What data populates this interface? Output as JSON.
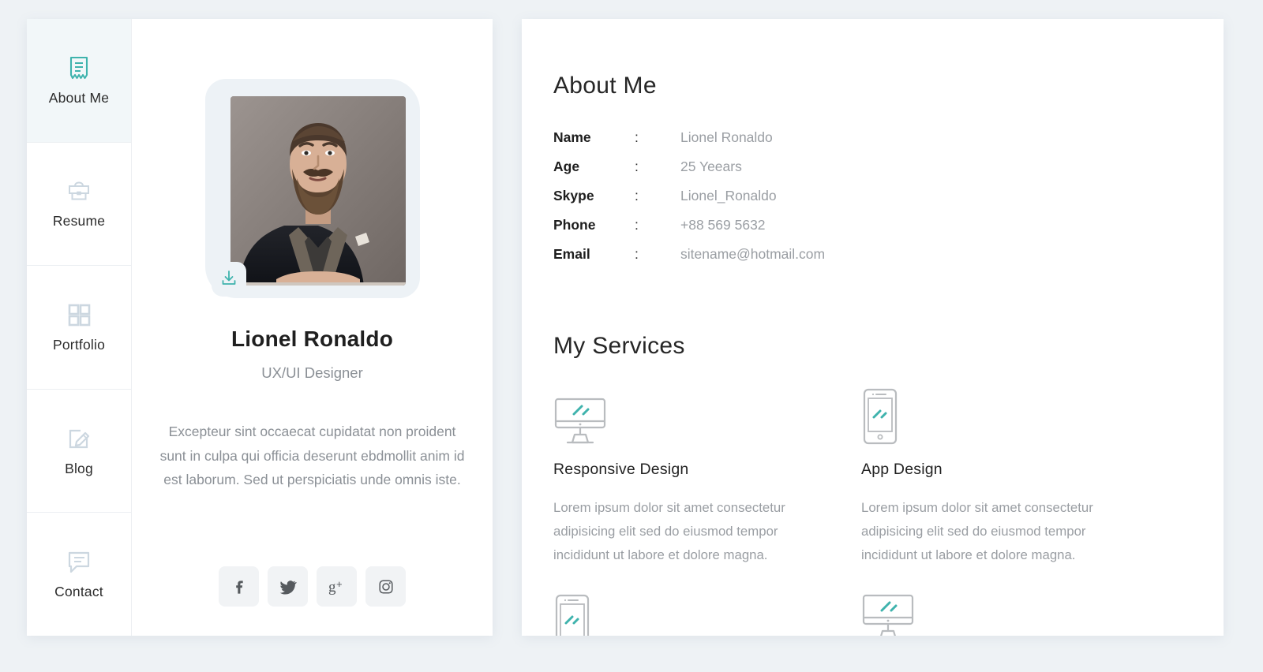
{
  "theme": {
    "page_bg": "#eef2f5",
    "card_bg": "#ffffff",
    "accent_teal": "#3fb3ad",
    "icon_gray": "#ccd7e0",
    "active_nav_bg": "#f2f7f9",
    "muted_text": "#9a9ea3",
    "dark_text": "#1e1e1e"
  },
  "sidebar": {
    "items": [
      {
        "label": "About Me",
        "icon": "receipt-icon",
        "active": true
      },
      {
        "label": "Resume",
        "icon": "briefcase-icon",
        "active": false
      },
      {
        "label": "Portfolio",
        "icon": "grid-icon",
        "active": false
      },
      {
        "label": "Blog",
        "icon": "pencil-icon",
        "active": false
      },
      {
        "label": "Contact",
        "icon": "chat-icon",
        "active": false
      }
    ]
  },
  "profile": {
    "photo_alt": "bearded man in dark suit portrait",
    "download_icon": "download-icon",
    "name": "Lionel Ronaldo",
    "role": "UX/UI Designer",
    "bio": "Excepteur sint occaecat cupidatat non proident sunt in culpa qui officia deserunt ebdmollit anim id est laborum. Sed ut perspiciatis unde omnis iste.",
    "socials": [
      {
        "name": "facebook",
        "icon": "facebook-icon"
      },
      {
        "name": "twitter",
        "icon": "twitter-icon"
      },
      {
        "name": "googleplus",
        "icon": "google-plus-icon"
      },
      {
        "name": "instagram",
        "icon": "instagram-icon"
      }
    ]
  },
  "about": {
    "title": "About Me",
    "separator": ":",
    "rows": [
      {
        "label": "Name",
        "value": "Lionel Ronaldo"
      },
      {
        "label": "Age",
        "value": "25 Yeears"
      },
      {
        "label": "Skype",
        "value": "Lionel_Ronaldo"
      },
      {
        "label": "Phone",
        "value": "+88 569 5632"
      },
      {
        "label": "Email",
        "value": "sitename@hotmail.com"
      }
    ],
    "signature_icon": "signature-icon"
  },
  "services": {
    "title": "My Services",
    "items": [
      {
        "icon": "monitor-icon",
        "title": "Responsive Design",
        "desc": "Lorem ipsum dolor sit amet consectetur adipisicing elit sed do eiusmod tempor incididunt ut labore et dolore magna."
      },
      {
        "icon": "phone-icon",
        "title": "App Design",
        "desc": "Lorem ipsum dolor sit amet consectetur adipisicing elit sed do eiusmod tempor incididunt ut labore et dolore magna."
      }
    ],
    "items_row2": [
      {
        "icon": "phone-icon",
        "title": "",
        "desc": ""
      },
      {
        "icon": "monitor-icon",
        "title": "",
        "desc": ""
      }
    ]
  }
}
